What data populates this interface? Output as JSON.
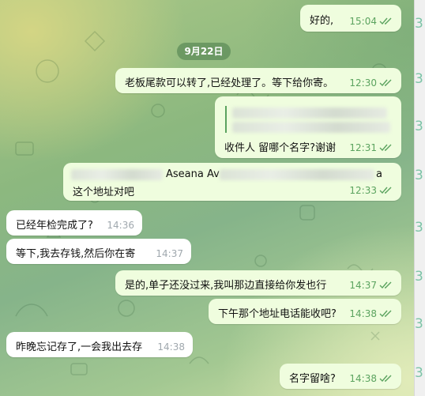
{
  "date_separator": "9月22日",
  "messages": [
    {
      "id": "m1",
      "dir": "out",
      "text": "好的,",
      "time": "15:04"
    },
    {
      "id": "m2",
      "dir": "out",
      "text": "老板尾款可以转了,已经处理了。等下给你寄。",
      "time": "12:30"
    },
    {
      "id": "m3",
      "dir": "out",
      "text": "收件人 留哪个名字?谢谢",
      "time": "12:31"
    },
    {
      "id": "m4",
      "dir": "out",
      "text_line1_partial": "Aseana Av",
      "text_line1_end": "a",
      "text_line2": "这个地址对吧",
      "time": "12:33"
    },
    {
      "id": "m5",
      "dir": "in",
      "text": "已经年检完成了?",
      "time": "14:36"
    },
    {
      "id": "m6",
      "dir": "in",
      "text": "等下,我去存钱,然后你在寄",
      "time": "14:37"
    },
    {
      "id": "m7",
      "dir": "out",
      "text": "是的,单子还没过来,我叫那边直接给你发也行",
      "time": "14:37"
    },
    {
      "id": "m8",
      "dir": "out",
      "text": "下午那个地址电话能收吧?",
      "time": "14:38"
    },
    {
      "id": "m9",
      "dir": "in",
      "text": "昨晚忘记存了,一会我出去存",
      "time": "14:38"
    },
    {
      "id": "m10",
      "dir": "out",
      "text": "名字留啥?",
      "time": "14:38"
    }
  ],
  "side_strip": [
    "3",
    "3",
    "3",
    "3",
    "3",
    "3",
    "3",
    "3"
  ],
  "colors": {
    "out_bubble": "#effdde",
    "in_bubble": "#ffffff",
    "read_check": "#5ba35f",
    "date_pill": "#5c8a58"
  }
}
